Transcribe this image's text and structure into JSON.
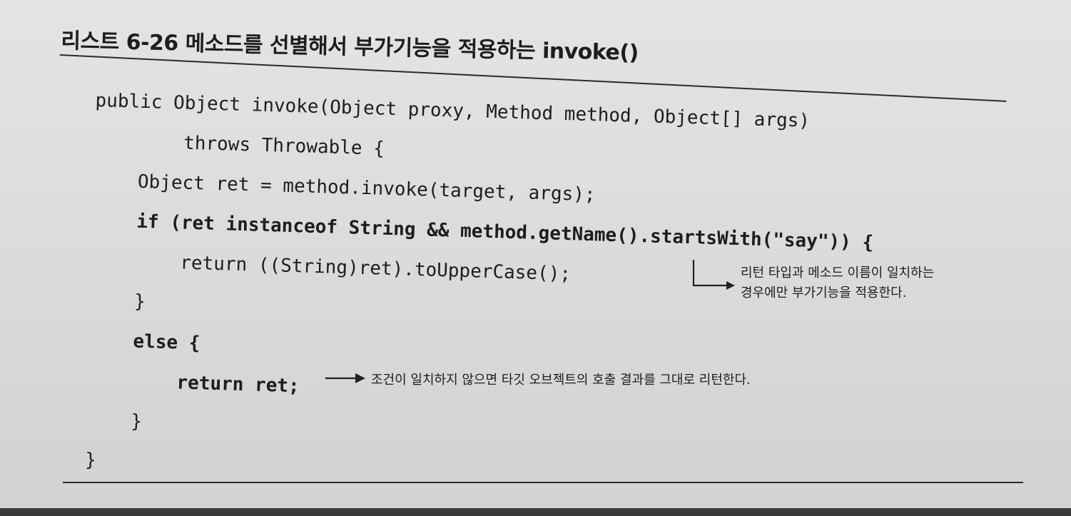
{
  "listing": {
    "title": "리스트 6-26 메소드를 선별해서 부가기능을 적용하는 invoke()"
  },
  "code": {
    "lines": [
      "public Object invoke(Object proxy, Method method, Object[] args)",
      "        throws Throwable {",
      "    Object ret = method.invoke(target, args);",
      "    if (ret instanceof String && method.getName().startsWith(\"say\")) {",
      "        return ((String)ret).toUpperCase();",
      "    }",
      "    else {",
      "        return ret;",
      "    }",
      "}"
    ]
  },
  "annotations": {
    "return_type_line1": "리턴 타입과 메소드 이름이 일치하는",
    "return_type_line2": "경우에만 부가기능을 적용한다.",
    "else_note": "조건이 일치하지 않으면 타깃 오브젝트의 호출 결과를 그대로 리턴한다."
  },
  "icons": {
    "bracket_arrow": "bent-arrow-icon",
    "right_arrow": "right-arrow-icon"
  }
}
